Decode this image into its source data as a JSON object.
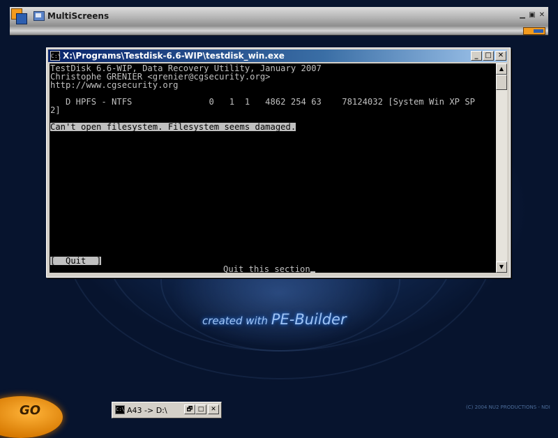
{
  "multiscreens": {
    "title": "MultiScreens",
    "controls": {
      "minimize": "▁",
      "restore": "▣",
      "close": "✕"
    }
  },
  "console_window": {
    "title": "X:\\Programs\\Testdisk-6.6-WIP\\testdisk_win.exe",
    "icon_text": "C:\\",
    "controls": {
      "minimize": "_",
      "maximize": "□",
      "close": "✕"
    },
    "lines": [
      "TestDisk 6.6-WIP, Data Recovery Utility, January 2007",
      "Christophe GRENIER <grenier@cgsecurity.org>",
      "http://www.cgsecurity.org",
      "",
      "   D HPFS - NTFS               0   1  1   4862 254 63    78124032 [System Win XP SP",
      "2]",
      "",
      "Can't open filesystem. Filesystem seems damaged."
    ],
    "error_line_index": 7,
    "quit_button": "[  Quit  ]",
    "status": "Quit this section",
    "scroll": {
      "up": "▲",
      "down": "▼"
    }
  },
  "watermark": {
    "prefix": "created with ",
    "name": "PE-Builder"
  },
  "go_button": "GO",
  "taskbar_window": {
    "title": "A43 -> D:\\",
    "icon_text": "C:\\",
    "controls": {
      "restore": "🗗",
      "maximize": "□",
      "close": "✕"
    }
  },
  "copyright": "(C) 2004 NU2 PRODUCTIONS - NDI"
}
